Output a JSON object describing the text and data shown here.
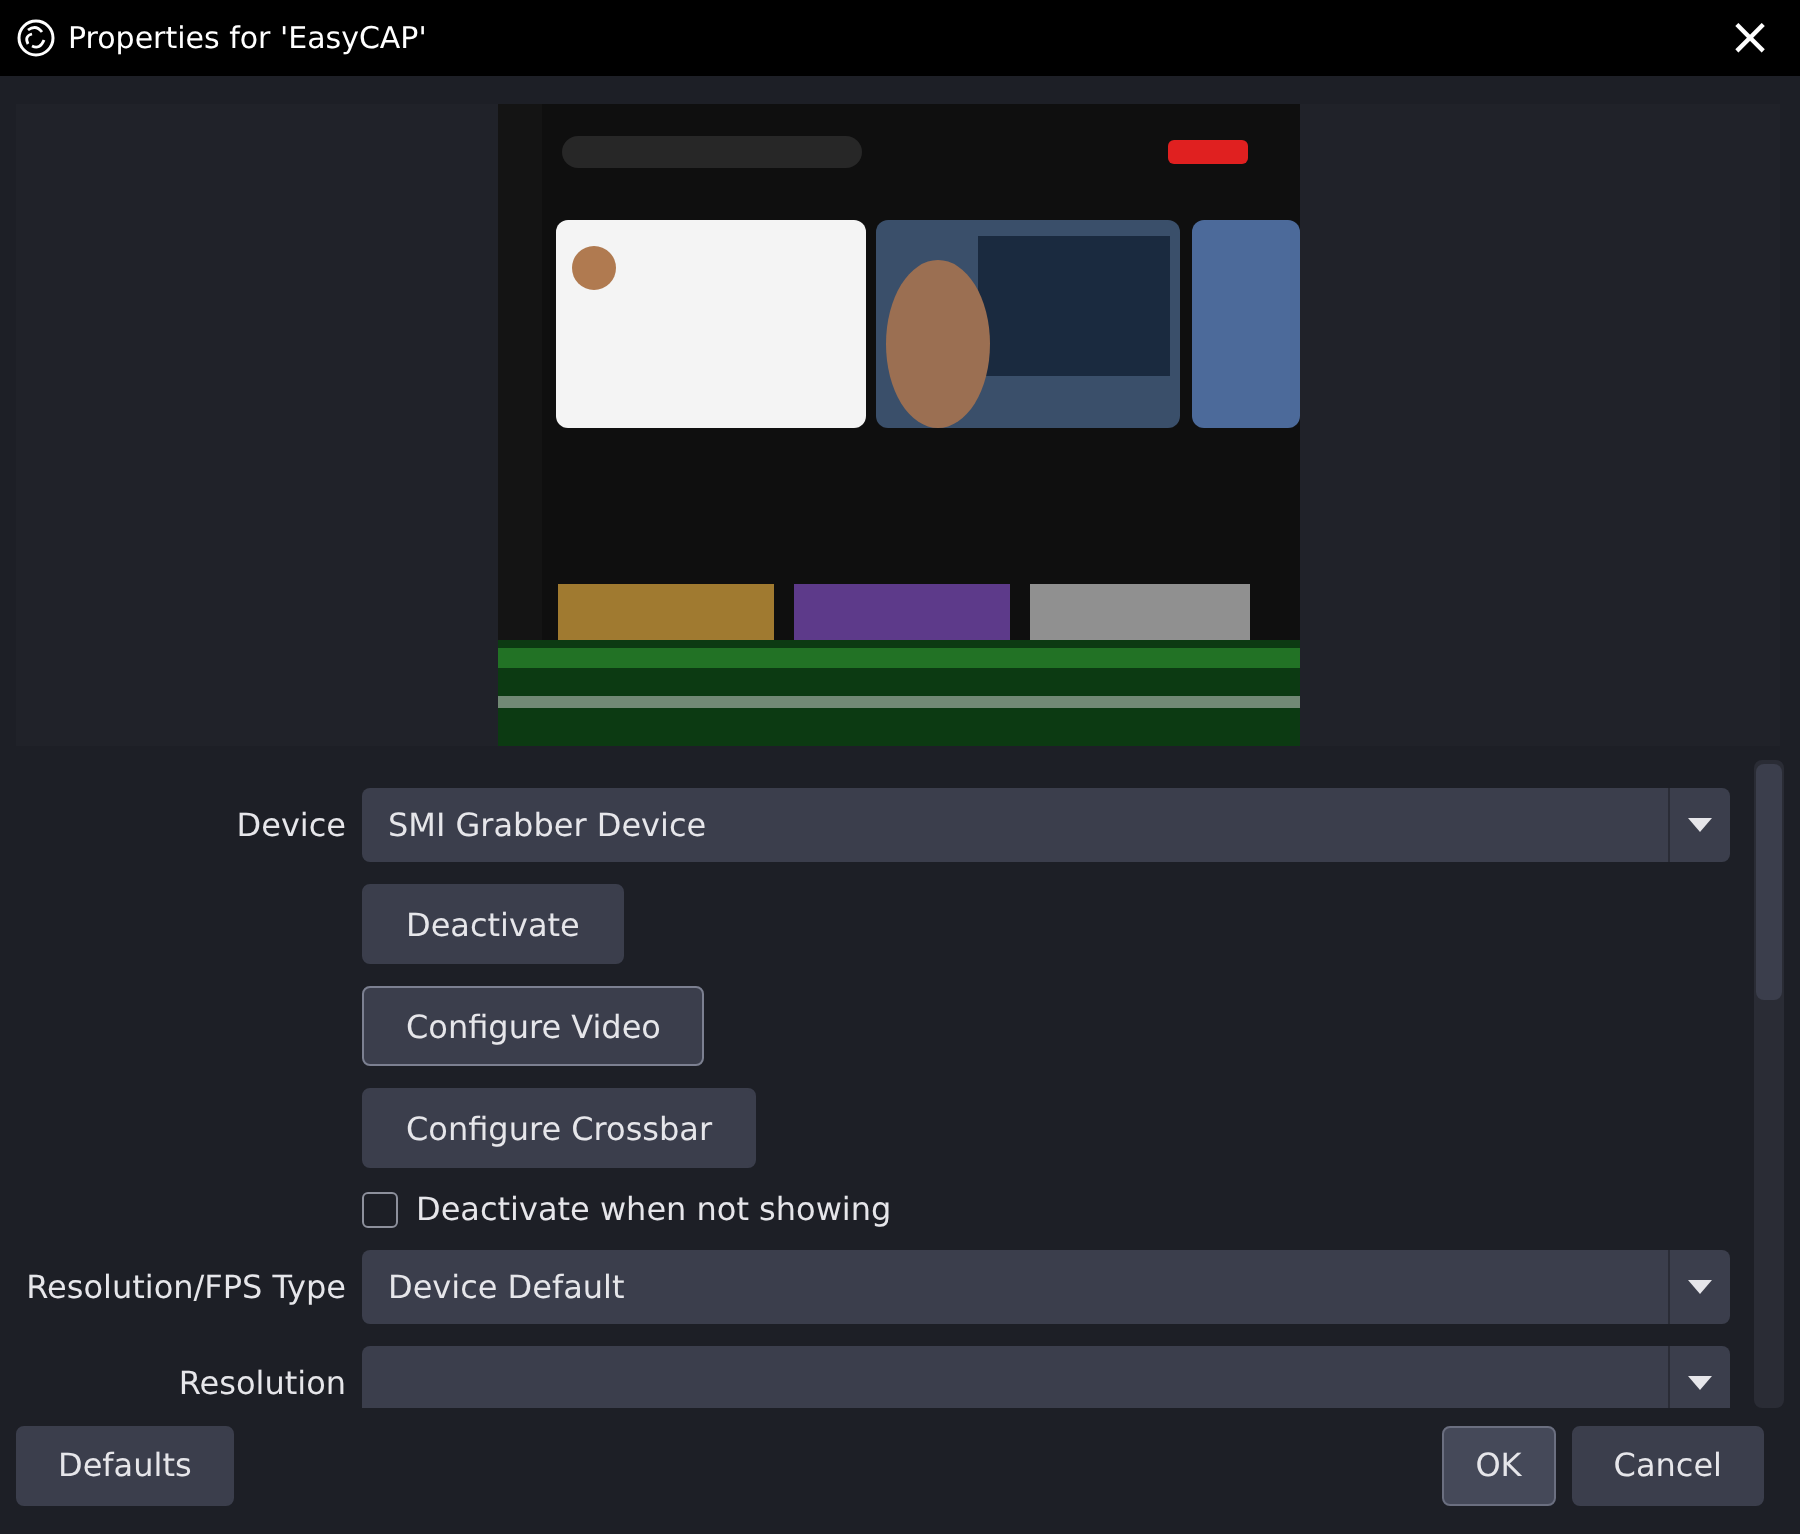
{
  "window": {
    "title": "Properties for 'EasyCAP'",
    "close": "×"
  },
  "properties": [
    {
      "kind": "combo",
      "label": "Device",
      "value": "SMI Grabber Device"
    },
    {
      "kind": "button",
      "label": "Deactivate",
      "focused": false
    },
    {
      "kind": "button",
      "label": "Configure Video",
      "focused": true
    },
    {
      "kind": "button",
      "label": "Configure Crossbar",
      "focused": false
    },
    {
      "kind": "checkbox",
      "label": "Deactivate when not showing",
      "checked": false
    },
    {
      "kind": "combo",
      "label": "Resolution/FPS Type",
      "value": "Device Default"
    },
    {
      "kind": "combo",
      "label": "Resolution"
    }
  ],
  "footer": {
    "left_buttons": [
      {
        "label": "Defaults",
        "hovered": false
      }
    ],
    "right_buttons": [
      {
        "label": "OK",
        "hovered": true
      },
      {
        "label": "Cancel",
        "hovered": false
      }
    ]
  }
}
